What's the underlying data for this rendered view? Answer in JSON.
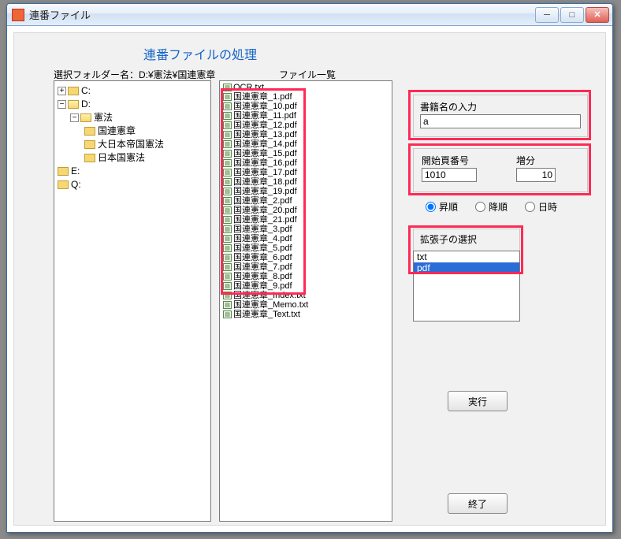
{
  "window": {
    "title": "連番ファイル"
  },
  "heading": "連番ファイルの処理",
  "labels": {
    "folder": "選択フォルダー名：D:¥憲法¥国連憲章",
    "filelist": "ファイル一覧",
    "bookname": "書籍名の入力",
    "startpage": "開始頁番号",
    "increment": "増分",
    "sort_asc": "昇順",
    "sort_desc": "降順",
    "sort_date": "日時",
    "ext_select": "拡張子の選択",
    "exec": "実行",
    "exit": "終了"
  },
  "inputs": {
    "bookname_value": "a",
    "startpage_value": "1010",
    "increment_value": "10",
    "sort_selected": "asc"
  },
  "tree": {
    "c": "C:",
    "d": "D:",
    "d_kenpo": "憲法",
    "d_kenpo_kokuren": "国連憲章",
    "d_kenpo_dainihon": "大日本帝国憲法",
    "d_kenpo_nihon": "日本国憲法",
    "e": "E:",
    "q": "Q:"
  },
  "files": [
    "OCR.txt",
    "国連憲章_1.pdf",
    "国連憲章_10.pdf",
    "国連憲章_11.pdf",
    "国連憲章_12.pdf",
    "国連憲章_13.pdf",
    "国連憲章_14.pdf",
    "国連憲章_15.pdf",
    "国連憲章_16.pdf",
    "国連憲章_17.pdf",
    "国連憲章_18.pdf",
    "国連憲章_19.pdf",
    "国連憲章_2.pdf",
    "国連憲章_20.pdf",
    "国連憲章_21.pdf",
    "国連憲章_3.pdf",
    "国連憲章_4.pdf",
    "国連憲章_5.pdf",
    "国連憲章_6.pdf",
    "国連憲章_7.pdf",
    "国連憲章_8.pdf",
    "国連憲章_9.pdf",
    "国連憲章_Index.txt",
    "国連憲章_Memo.txt",
    "国連憲章_Text.txt"
  ],
  "extensions": [
    "txt",
    "pdf"
  ],
  "ext_selected": "pdf"
}
